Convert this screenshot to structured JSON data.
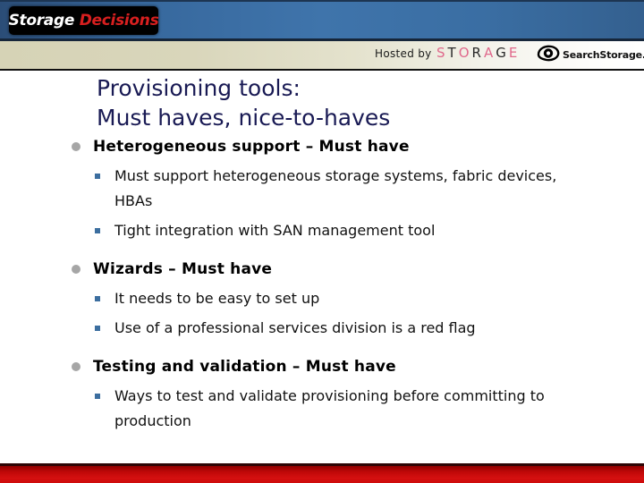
{
  "header": {
    "brand_logo": {
      "part1": "Storage",
      "part2": "Decisions"
    },
    "hosted_by_label": "Hosted by",
    "storage_wordmark": [
      "S",
      "T",
      "O",
      "R",
      "A",
      "G",
      "E"
    ],
    "searchstorage_label": "SearchStorage.com"
  },
  "slide": {
    "title": "Provisioning tools:\nMust haves, nice-to-haves",
    "groups": [
      {
        "heading": "Heterogeneous support – Must have",
        "subpoints": [
          "Must support heterogeneous storage systems, fabric devices, HBAs",
          "Tight integration with SAN management tool"
        ]
      },
      {
        "heading": "Wizards – Must have",
        "subpoints": [
          "It needs to be easy to set up",
          "Use of a professional services division is a red flag"
        ]
      },
      {
        "heading": "Testing and validation – Must have",
        "subpoints": [
          "Ways to test and validate provisioning before committing to production"
        ]
      }
    ]
  },
  "colors": {
    "title": "#191a54",
    "header_blue": "#3a6ea3",
    "header_beige": "#d6d3b6",
    "footer_red": "#c00808",
    "bullet_level1": "#a6a6a6",
    "bullet_level2": "#3c6e9f",
    "logo_accent_red": "#d81f1f",
    "wordmark_pink": "#e0698c"
  }
}
